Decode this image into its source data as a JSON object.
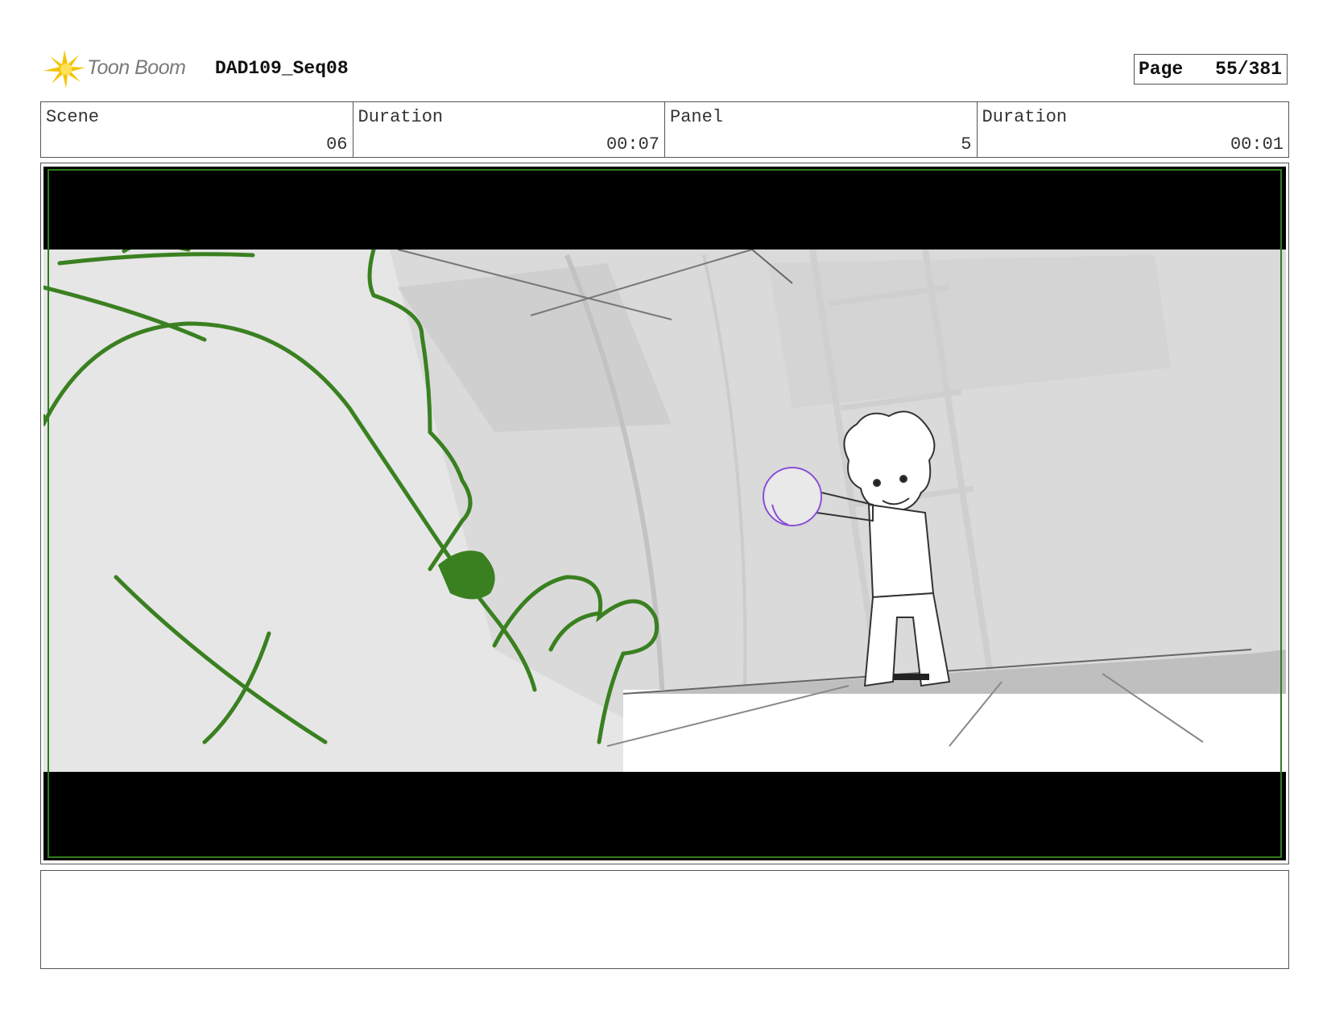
{
  "header": {
    "logo_text": "Toon Boom",
    "logo_icon": "starburst-icon",
    "title": "DAD109_Seq08",
    "page_label": "Page",
    "page_value": "55/381"
  },
  "info": {
    "scene_label": "Scene",
    "scene_value": "06",
    "scene_duration_label": "Duration",
    "scene_duration_value": "00:07",
    "panel_label": "Panel",
    "panel_value": "5",
    "panel_duration_label": "Duration",
    "panel_duration_value": "00:01"
  },
  "panel": {
    "letterbox_color": "#000000",
    "safe_frame_color": "#2e7d1e",
    "foreground_character_color": "#3a8020",
    "glow_orb_color": "#8a4fd6"
  },
  "notes": {
    "text": ""
  }
}
